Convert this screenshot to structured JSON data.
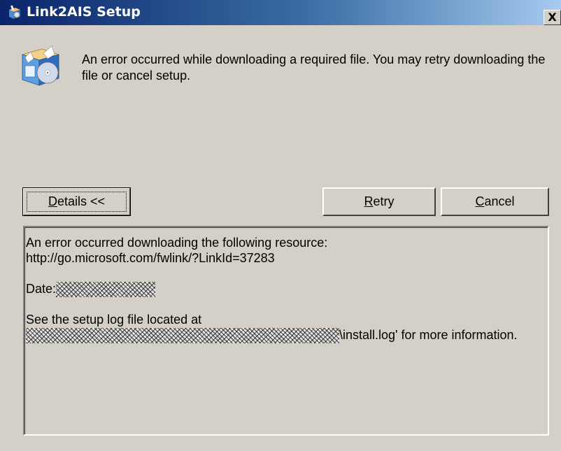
{
  "window": {
    "title": "Link2AIS Setup",
    "close_label": "X"
  },
  "message": {
    "text": "An error occurred while downloading a required file. You may retry downloading the file or cancel setup."
  },
  "buttons": {
    "details": {
      "mnemonic": "D",
      "rest": "etails <<"
    },
    "retry": {
      "mnemonic": "R",
      "rest": "etry"
    },
    "cancel": {
      "mnemonic": "C",
      "rest": "ancel"
    }
  },
  "details_log": {
    "line1": "An error occurred downloading the following resource:",
    "line2": "http://go.microsoft.com/fwlink/?LinkId=37283",
    "date_label": "Date:",
    "setup_log_intro": "See the setup log file located at",
    "setup_log_suffix": "\\install.log' for more information."
  },
  "colors": {
    "dialog_bg": "#d4d0c8",
    "title_start": "#0a246a",
    "title_end": "#a6caf0"
  },
  "icons": {
    "title": "setup-box-icon",
    "main": "setup-box-cd-icon"
  }
}
